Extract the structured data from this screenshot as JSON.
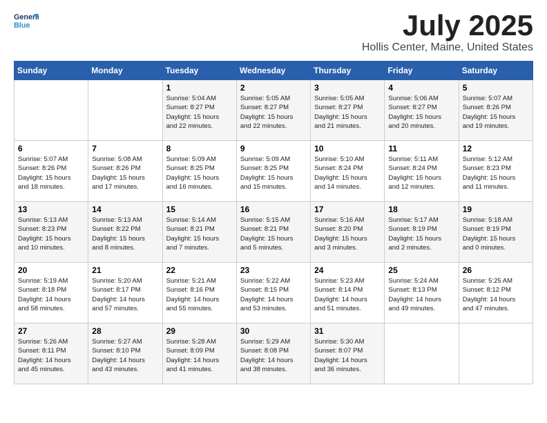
{
  "logo": {
    "line1": "General",
    "line2": "Blue"
  },
  "title": "July 2025",
  "subtitle": "Hollis Center, Maine, United States",
  "weekdays": [
    "Sunday",
    "Monday",
    "Tuesday",
    "Wednesday",
    "Thursday",
    "Friday",
    "Saturday"
  ],
  "weeks": [
    [
      {
        "day": "",
        "info": ""
      },
      {
        "day": "",
        "info": ""
      },
      {
        "day": "1",
        "info": "Sunrise: 5:04 AM\nSunset: 8:27 PM\nDaylight: 15 hours\nand 22 minutes."
      },
      {
        "day": "2",
        "info": "Sunrise: 5:05 AM\nSunset: 8:27 PM\nDaylight: 15 hours\nand 22 minutes."
      },
      {
        "day": "3",
        "info": "Sunrise: 5:05 AM\nSunset: 8:27 PM\nDaylight: 15 hours\nand 21 minutes."
      },
      {
        "day": "4",
        "info": "Sunrise: 5:06 AM\nSunset: 8:27 PM\nDaylight: 15 hours\nand 20 minutes."
      },
      {
        "day": "5",
        "info": "Sunrise: 5:07 AM\nSunset: 8:26 PM\nDaylight: 15 hours\nand 19 minutes."
      }
    ],
    [
      {
        "day": "6",
        "info": "Sunrise: 5:07 AM\nSunset: 8:26 PM\nDaylight: 15 hours\nand 18 minutes."
      },
      {
        "day": "7",
        "info": "Sunrise: 5:08 AM\nSunset: 8:26 PM\nDaylight: 15 hours\nand 17 minutes."
      },
      {
        "day": "8",
        "info": "Sunrise: 5:09 AM\nSunset: 8:25 PM\nDaylight: 15 hours\nand 16 minutes."
      },
      {
        "day": "9",
        "info": "Sunrise: 5:09 AM\nSunset: 8:25 PM\nDaylight: 15 hours\nand 15 minutes."
      },
      {
        "day": "10",
        "info": "Sunrise: 5:10 AM\nSunset: 8:24 PM\nDaylight: 15 hours\nand 14 minutes."
      },
      {
        "day": "11",
        "info": "Sunrise: 5:11 AM\nSunset: 8:24 PM\nDaylight: 15 hours\nand 12 minutes."
      },
      {
        "day": "12",
        "info": "Sunrise: 5:12 AM\nSunset: 8:23 PM\nDaylight: 15 hours\nand 11 minutes."
      }
    ],
    [
      {
        "day": "13",
        "info": "Sunrise: 5:13 AM\nSunset: 8:23 PM\nDaylight: 15 hours\nand 10 minutes."
      },
      {
        "day": "14",
        "info": "Sunrise: 5:13 AM\nSunset: 8:22 PM\nDaylight: 15 hours\nand 8 minutes."
      },
      {
        "day": "15",
        "info": "Sunrise: 5:14 AM\nSunset: 8:21 PM\nDaylight: 15 hours\nand 7 minutes."
      },
      {
        "day": "16",
        "info": "Sunrise: 5:15 AM\nSunset: 8:21 PM\nDaylight: 15 hours\nand 5 minutes."
      },
      {
        "day": "17",
        "info": "Sunrise: 5:16 AM\nSunset: 8:20 PM\nDaylight: 15 hours\nand 3 minutes."
      },
      {
        "day": "18",
        "info": "Sunrise: 5:17 AM\nSunset: 8:19 PM\nDaylight: 15 hours\nand 2 minutes."
      },
      {
        "day": "19",
        "info": "Sunrise: 5:18 AM\nSunset: 8:19 PM\nDaylight: 15 hours\nand 0 minutes."
      }
    ],
    [
      {
        "day": "20",
        "info": "Sunrise: 5:19 AM\nSunset: 8:18 PM\nDaylight: 14 hours\nand 58 minutes."
      },
      {
        "day": "21",
        "info": "Sunrise: 5:20 AM\nSunset: 8:17 PM\nDaylight: 14 hours\nand 57 minutes."
      },
      {
        "day": "22",
        "info": "Sunrise: 5:21 AM\nSunset: 8:16 PM\nDaylight: 14 hours\nand 55 minutes."
      },
      {
        "day": "23",
        "info": "Sunrise: 5:22 AM\nSunset: 8:15 PM\nDaylight: 14 hours\nand 53 minutes."
      },
      {
        "day": "24",
        "info": "Sunrise: 5:23 AM\nSunset: 8:14 PM\nDaylight: 14 hours\nand 51 minutes."
      },
      {
        "day": "25",
        "info": "Sunrise: 5:24 AM\nSunset: 8:13 PM\nDaylight: 14 hours\nand 49 minutes."
      },
      {
        "day": "26",
        "info": "Sunrise: 5:25 AM\nSunset: 8:12 PM\nDaylight: 14 hours\nand 47 minutes."
      }
    ],
    [
      {
        "day": "27",
        "info": "Sunrise: 5:26 AM\nSunset: 8:11 PM\nDaylight: 14 hours\nand 45 minutes."
      },
      {
        "day": "28",
        "info": "Sunrise: 5:27 AM\nSunset: 8:10 PM\nDaylight: 14 hours\nand 43 minutes."
      },
      {
        "day": "29",
        "info": "Sunrise: 5:28 AM\nSunset: 8:09 PM\nDaylight: 14 hours\nand 41 minutes."
      },
      {
        "day": "30",
        "info": "Sunrise: 5:29 AM\nSunset: 8:08 PM\nDaylight: 14 hours\nand 38 minutes."
      },
      {
        "day": "31",
        "info": "Sunrise: 5:30 AM\nSunset: 8:07 PM\nDaylight: 14 hours\nand 36 minutes."
      },
      {
        "day": "",
        "info": ""
      },
      {
        "day": "",
        "info": ""
      }
    ]
  ]
}
